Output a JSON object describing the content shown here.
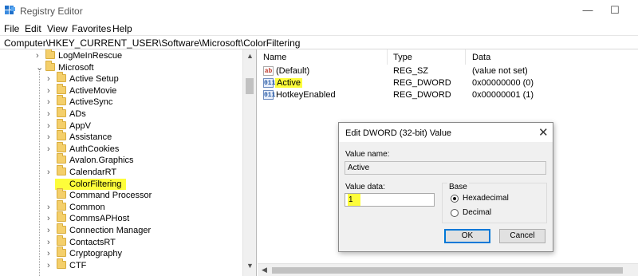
{
  "window": {
    "title": "Registry Editor",
    "minimize_glyph": "—",
    "maximize_glyph": "☐"
  },
  "menu": [
    "File",
    "Edit",
    "View",
    "Favorites",
    "Help"
  ],
  "address": "Computer\\HKEY_CURRENT_USER\\Software\\Microsoft\\ColorFiltering",
  "tree": {
    "items": [
      {
        "label": "LogMeInRescue",
        "expander": ">",
        "highlighted": false
      },
      {
        "label": "Microsoft",
        "expander": "v",
        "highlighted": false
      },
      {
        "label": "Active Setup",
        "expander": ">",
        "highlighted": false
      },
      {
        "label": "ActiveMovie",
        "expander": ">",
        "highlighted": false
      },
      {
        "label": "ActiveSync",
        "expander": ">",
        "highlighted": false
      },
      {
        "label": "ADs",
        "expander": ">",
        "highlighted": false
      },
      {
        "label": "AppV",
        "expander": ">",
        "highlighted": false
      },
      {
        "label": "Assistance",
        "expander": ">",
        "highlighted": false
      },
      {
        "label": "AuthCookies",
        "expander": ">",
        "highlighted": false
      },
      {
        "label": "Avalon.Graphics",
        "expander": "",
        "highlighted": false
      },
      {
        "label": "CalendarRT",
        "expander": ">",
        "highlighted": false
      },
      {
        "label": "ColorFiltering",
        "expander": "",
        "highlighted": true
      },
      {
        "label": "Command Processor",
        "expander": "",
        "highlighted": false
      },
      {
        "label": "Common",
        "expander": ">",
        "highlighted": false
      },
      {
        "label": "CommsAPHost",
        "expander": ">",
        "highlighted": false
      },
      {
        "label": "Connection Manager",
        "expander": ">",
        "highlighted": false
      },
      {
        "label": "ContactsRT",
        "expander": ">",
        "highlighted": false
      },
      {
        "label": "Cryptography",
        "expander": ">",
        "highlighted": false
      },
      {
        "label": "CTF",
        "expander": ">",
        "highlighted": false
      }
    ]
  },
  "list": {
    "headers": {
      "name": "Name",
      "type": "Type",
      "data": "Data"
    },
    "rows": [
      {
        "icon": "ab",
        "name": "(Default)",
        "type": "REG_SZ",
        "data": "(value not set)",
        "highlighted": false
      },
      {
        "icon": "011",
        "name": "Active",
        "type": "REG_DWORD",
        "data": "0x00000000 (0)",
        "highlighted": true
      },
      {
        "icon": "011",
        "name": "HotkeyEnabled",
        "type": "REG_DWORD",
        "data": "0x00000001 (1)",
        "highlighted": false
      }
    ]
  },
  "dialog": {
    "title": "Edit DWORD (32-bit) Value",
    "close_glyph": "✕",
    "value_name_label": "Value name:",
    "value_name": "Active",
    "value_data_label": "Value data:",
    "value_data": "1",
    "base_label": "Base",
    "base_options": [
      {
        "label": "Hexadecimal",
        "checked": true
      },
      {
        "label": "Decimal",
        "checked": false
      }
    ],
    "ok_label": "OK",
    "cancel_label": "Cancel"
  },
  "colors": {
    "highlight": "#fdfd3a",
    "folder": "#f4cf6b",
    "accent": "#0078d7"
  }
}
